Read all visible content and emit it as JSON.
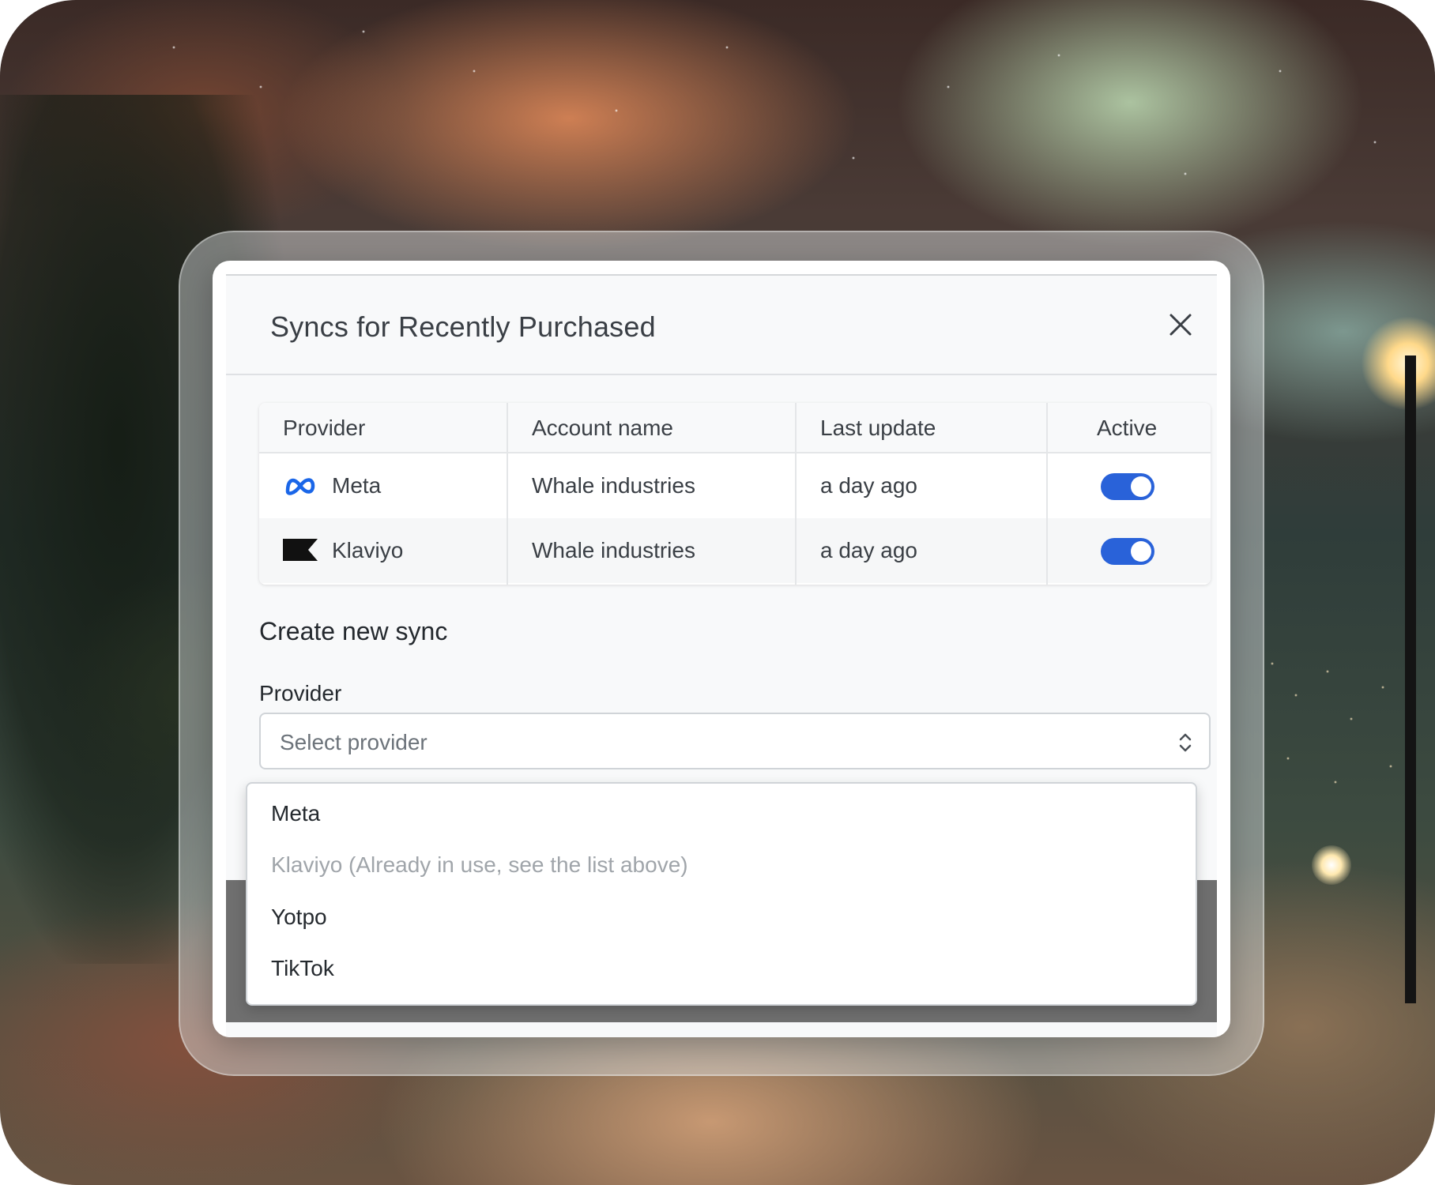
{
  "modal": {
    "title": "Syncs for Recently Purchased",
    "close_icon": "close-icon"
  },
  "table": {
    "headers": [
      "Provider",
      "Account name",
      "Last update",
      "Active"
    ],
    "rows": [
      {
        "provider": "Meta",
        "icon": "meta-logo-icon",
        "account": "Whale industries",
        "updated": "a day ago",
        "active": true
      },
      {
        "provider": "Klaviyo",
        "icon": "klaviyo-logo-icon",
        "account": "Whale industries",
        "updated": "a day ago",
        "active": true
      }
    ]
  },
  "create": {
    "section_title": "Create new sync",
    "provider_label": "Provider",
    "select_placeholder": "Select provider",
    "options": [
      {
        "label": "Meta",
        "disabled": false
      },
      {
        "label": "Klaviyo (Already in use, see the list above)",
        "disabled": true
      },
      {
        "label": "Yotpo",
        "disabled": false
      },
      {
        "label": "TikTok",
        "disabled": false
      }
    ]
  },
  "colors": {
    "toggle_on": "#2962d9",
    "meta_blue": "#1a66e8"
  }
}
